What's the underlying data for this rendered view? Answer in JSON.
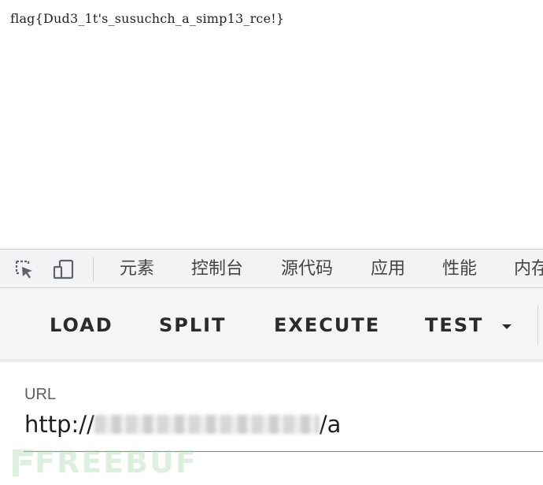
{
  "page": {
    "output_text": "flag{Dud3_1t's_susuchch_a_simp13_rce!}"
  },
  "devtools": {
    "tabs": [
      "元素",
      "控制台",
      "源代码",
      "应用",
      "性能",
      "内存"
    ],
    "icons": [
      "inspect-element-icon",
      "device-toolbar-icon"
    ]
  },
  "hackbar": {
    "buttons": {
      "load": "LOAD",
      "split": "SPLIT",
      "execute": "EXECUTE",
      "test": "TEST"
    },
    "url": {
      "label": "URL",
      "prefix": "http://",
      "suffix": "/a"
    }
  },
  "watermark": {
    "text": "FREEBUF"
  },
  "colors": {
    "toolbar_bg": "#f5f5f5",
    "devtools_bg": "#f1f3f4",
    "watermark": "#9fd3a6"
  }
}
